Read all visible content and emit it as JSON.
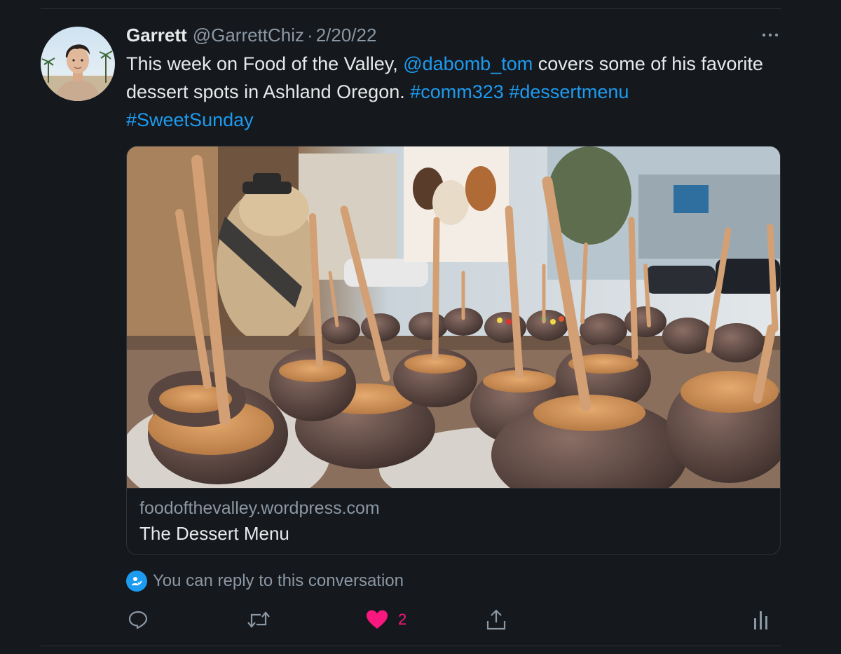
{
  "tweet": {
    "author_name": "Garrett",
    "author_handle": "@GarrettChiz",
    "separator": "·",
    "date": "2/20/22",
    "more_label": "···",
    "text": {
      "part1": "This week on Food of the Valley, ",
      "mention": "@dabomb_tom",
      "part2": " covers some of his favorite dessert spots in Ashland Oregon. ",
      "hashtag1": "#comm323",
      "space1": " ",
      "hashtag2": "#dessertmenu",
      "space2": " ",
      "hashtag3": "#SweetSunday"
    },
    "card": {
      "domain": "foodofthevalley.wordpress.com",
      "title": "The Dessert Menu"
    },
    "reply_restriction": "You can reply to this conversation",
    "likes": "2"
  },
  "icons": {
    "more": "more-icon",
    "reply_permission": "person-check-icon",
    "reply": "reply-icon",
    "retweet": "retweet-icon",
    "like": "heart-icon",
    "share": "share-icon",
    "analytics": "analytics-icon"
  },
  "colors": {
    "background": "#15181c",
    "link": "#1d9bf0",
    "secondary_text": "#8b98a5",
    "like_active": "#f91880",
    "border": "#2f3336"
  }
}
